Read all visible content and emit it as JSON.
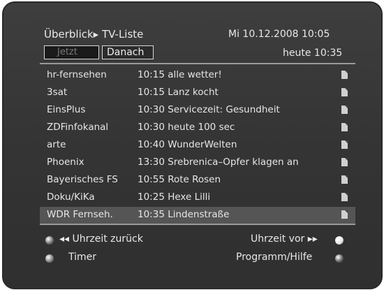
{
  "header": {
    "title": "Überblick▸ TV-Liste",
    "datetime": "Mi 10.12.2008  10:05",
    "time_context": "heute 10:35"
  },
  "tabs": [
    {
      "label": "Jetzt",
      "active": false
    },
    {
      "label": "Danach",
      "active": true
    }
  ],
  "rows": [
    {
      "channel": "hr-fernsehen",
      "programme": "10:15 alle wetter!"
    },
    {
      "channel": "3sat",
      "programme": "10:15 Lanz kocht"
    },
    {
      "channel": "EinsPlus",
      "programme": "10:30 Servicezeit: Gesundheit"
    },
    {
      "channel": "ZDFinfokanal",
      "programme": "10:30 heute 100 sec"
    },
    {
      "channel": "arte",
      "programme": "10:40 WunderWelten"
    },
    {
      "channel": "Phoenix",
      "programme": "13:30 Srebrenica–Opfer klagen an"
    },
    {
      "channel": "Bayerisches FS",
      "programme": "10:55 Rote Rosen"
    },
    {
      "channel": "Doku/KiKa",
      "programme": "10:25 Hexe Lilli"
    },
    {
      "channel": "WDR Fernseh.",
      "programme": "10:35 Lindenstraße"
    }
  ],
  "selected_row": 8,
  "footer": {
    "back_label": "◂◂ Uhrzeit zurück",
    "forward_label": "Uhrzeit vor ▸▸",
    "timer_label": "Timer",
    "help_label": "Programm/Hilfe"
  },
  "colors": {
    "button_red": "#6a6a6a",
    "button_green": "#7a7a7a",
    "button_yellow": "#e6e6e6",
    "button_blue": "#5a5a5a"
  },
  "icons": {
    "row_info": "info-document-icon"
  }
}
